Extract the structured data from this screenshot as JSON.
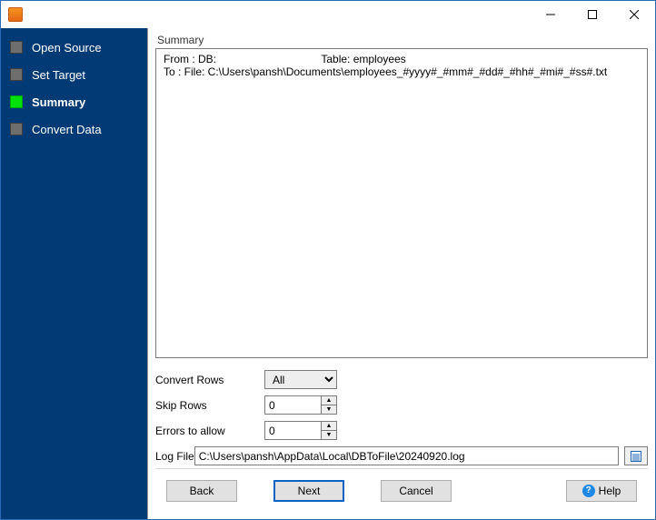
{
  "sidebar": {
    "items": [
      {
        "label": "Open Source",
        "active": false
      },
      {
        "label": "Set Target",
        "active": false
      },
      {
        "label": "Summary",
        "active": true
      },
      {
        "label": "Convert Data",
        "active": false
      }
    ]
  },
  "main": {
    "section_title": "Summary",
    "summary": {
      "from_label": "From : DB:",
      "from_table_label": "Table: employees",
      "to_line": "To : File: C:\\Users\\pansh\\Documents\\employees_#yyyy#_#mm#_#dd#_#hh#_#mi#_#ss#.txt"
    },
    "form": {
      "convert_rows_label": "Convert Rows",
      "convert_rows_value": "All",
      "skip_rows_label": "Skip Rows",
      "skip_rows_value": "0",
      "errors_label": "Errors to allow",
      "errors_value": "0",
      "log_file_label": "Log File",
      "log_file_value": "C:\\Users\\pansh\\AppData\\Local\\DBToFile\\20240920.log"
    }
  },
  "footer": {
    "back": "Back",
    "next": "Next",
    "cancel": "Cancel",
    "help": "Help"
  }
}
